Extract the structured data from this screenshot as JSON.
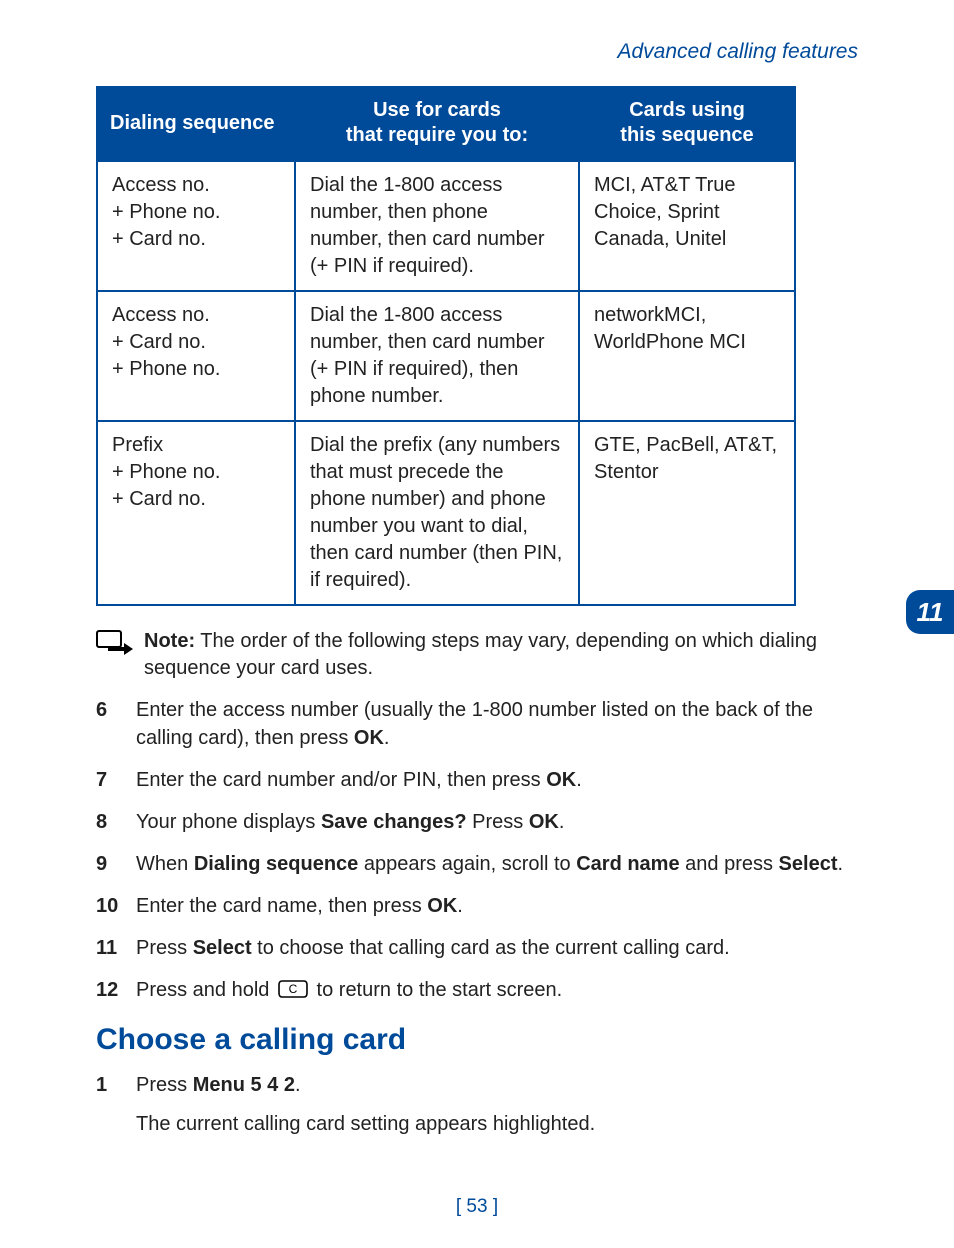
{
  "breadcrumb": "Advanced calling features",
  "tab_number": "11",
  "page_number": "[ 53 ]",
  "table": {
    "headers": {
      "col1": "Dialing sequence",
      "col2_line1": "Use for cards",
      "col2_line2": "that require you to:",
      "col3_line1": "Cards using",
      "col3_line2": "this sequence"
    },
    "rows": [
      {
        "seq": "Access no.\n+ Phone no.\n+ Card no.",
        "use": "Dial the 1-800 access number, then phone number, then card number (+ PIN if required).",
        "cards": "MCI, AT&T True Choice, Sprint Canada, Unitel"
      },
      {
        "seq": "Access no.\n+ Card no.\n+ Phone no.",
        "use": "Dial the 1-800 access number, then card number (+ PIN if required), then phone number.",
        "cards": "networkMCI, WorldPhone MCI"
      },
      {
        "seq": "Prefix\n+ Phone no.\n+ Card no.",
        "use": "Dial the prefix (any numbers that must precede the phone number) and phone number you want to dial, then card number (then PIN, if required).",
        "cards": "GTE, PacBell, AT&T, Stentor"
      }
    ]
  },
  "note": {
    "label": "Note:",
    "text": " The order of the following steps may vary, depending on which dialing sequence your card uses."
  },
  "steps_a": [
    {
      "n": "6",
      "prefix": "Enter the access number (usually the 1-800 number listed on the back of the calling card), then press ",
      "bold": "OK",
      "suffix": "."
    },
    {
      "n": "7",
      "prefix": "Enter the card number and/or PIN, then press ",
      "bold": "OK",
      "suffix": "."
    },
    {
      "n": "8",
      "prefix": "Your phone displays ",
      "bold": "Save changes?",
      "mid": " Press ",
      "bold2": "OK",
      "suffix": "."
    },
    {
      "n": "9",
      "prefix": "When ",
      "bold": "Dialing sequence",
      "mid": " appears again, scroll to ",
      "bold2": "Card name",
      "mid2": " and press ",
      "bold3": "Select",
      "suffix": "."
    },
    {
      "n": "10",
      "prefix": "Enter the card name, then press ",
      "bold": "OK",
      "suffix": "."
    },
    {
      "n": "11",
      "prefix": "Press ",
      "bold": "Select",
      "suffix": " to choose that calling card as the current calling card."
    },
    {
      "n": "12",
      "prefix": "Press and hold ",
      "key": "C",
      "suffix": " to return to the start screen."
    }
  ],
  "section_heading": "Choose a calling card",
  "steps_b": [
    {
      "n": "1",
      "prefix": "Press ",
      "bold": "Menu 5 4 2",
      "suffix": "."
    }
  ],
  "section_sub": "The current calling card setting appears highlighted."
}
